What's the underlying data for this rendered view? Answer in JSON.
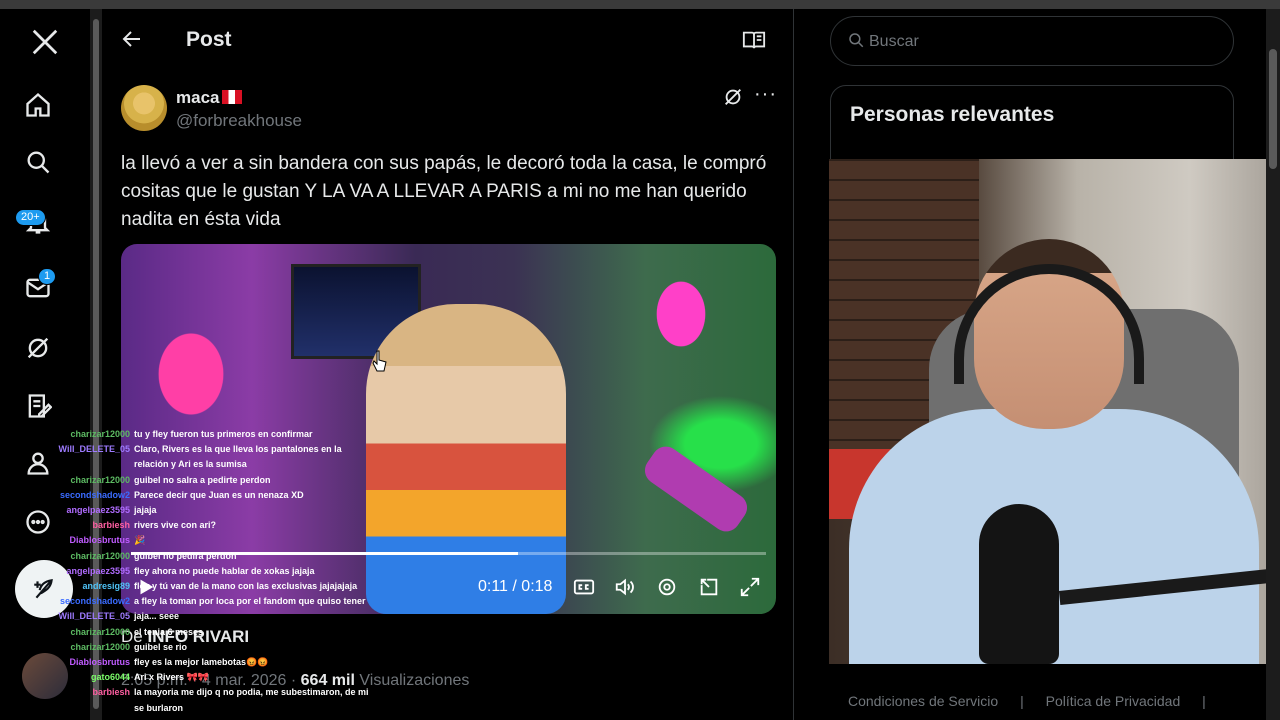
{
  "nav": {
    "notifications_badge": "20+",
    "messages_badge": "1"
  },
  "header": {
    "title": "Post"
  },
  "post": {
    "author_name": "maca",
    "author_handle": "@forbreakhouse",
    "text": "la llevó a ver a sin bandera con sus papás, le decoró toda la casa, le compró cositas que le gustan Y LA VA A LLEVAR A PARIS a mi no me han querido nadita en ésta vida",
    "video": {
      "time": "0:11 / 0:18",
      "progress_fraction": 0.61
    },
    "source_prefix": "De",
    "source_name": "INFO RIVARI",
    "date": "2:05 p.m. · 4 mar. 2026 ·",
    "views_count": "664 mil",
    "views_label": "Visualizaciones"
  },
  "sidebar": {
    "search_placeholder": "Buscar",
    "related_title": "Personas relevantes",
    "footer_terms": "Condiciones de Servicio",
    "footer_privacy": "Política de Privacidad",
    "footer_sep": "|"
  },
  "chat": [
    {
      "user": "charizar12000",
      "color": "#5dbb63",
      "msg": "tu y fley fueron tus primeros en confirmar"
    },
    {
      "user": "Will_DELETE_05",
      "color": "#9e7bff",
      "msg": "Claro, Rivers es la que lleva los pantalones en la"
    },
    {
      "user": "",
      "color": "#ffffff",
      "msg": "relación y Ari es la sumisa"
    },
    {
      "user": "charizar12000",
      "color": "#5dbb63",
      "msg": "guibel no salra a pedirte perdon"
    },
    {
      "user": "secondshadow2",
      "color": "#3a6bff",
      "msg": "Parece decir que Juan es un nenaza XD"
    },
    {
      "user": "angelpaez3595",
      "color": "#b06cff",
      "msg": "jajaja"
    },
    {
      "user": "barbiesh",
      "color": "#ff5fa2",
      "msg": "rivers vive con ari?"
    },
    {
      "user": "Diablosbrutus",
      "color": "#c05cff",
      "msg": "🎉"
    },
    {
      "user": "charizar12000",
      "color": "#5dbb63",
      "msg": "guibel no pedira perdon"
    },
    {
      "user": "angelpaez3595",
      "color": "#b06cff",
      "msg": "fley ahora no puede hablar de xokas jajaja"
    },
    {
      "user": "andresig89",
      "color": "#4fc3f7",
      "msg": "fley y tú van de la mano con las exclusivas jajajajaja"
    },
    {
      "user": "secondshadow2",
      "color": "#3a6bff",
      "msg": "a fley la toman por loca por el fandom que quiso tener"
    },
    {
      "user": "Will_DELETE_05",
      "color": "#9e7bff",
      "msg": "jaja... seee"
    },
    {
      "user": "charizar12000",
      "color": "#5dbb63",
      "msg": "el tenia 6 meses"
    },
    {
      "user": "charizar12000",
      "color": "#5dbb63",
      "msg": "guibel se rio"
    },
    {
      "user": "Diablosbrutus",
      "color": "#c05cff",
      "msg": "fley es la mejor lamebotas😡😡"
    },
    {
      "user": "gato6044",
      "color": "#7dff6b",
      "msg": "Ari x Rivers 🎀🎀"
    },
    {
      "user": "barbiesh",
      "color": "#ff5fa2",
      "msg": "la mayoria me dijo q no podia, me subestimaron, de mi"
    },
    {
      "user": "",
      "color": "#ffffff",
      "msg": "se burlaron"
    }
  ]
}
